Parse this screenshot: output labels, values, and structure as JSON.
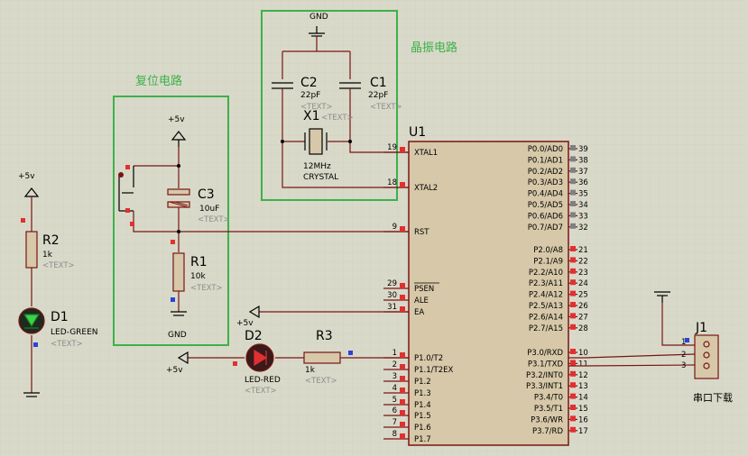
{
  "titles": {
    "reset": "复位电路",
    "crystal": "晶振电路"
  },
  "crystal": {
    "gnd": "GND",
    "c2": {
      "ref": "C2",
      "value": "22pF",
      "text": "<TEXT>"
    },
    "c1": {
      "ref": "C1",
      "value": "22pF",
      "text": "<TEXT>"
    },
    "x1": {
      "ref": "X1",
      "freq": "12MHz",
      "type": "CRYSTAL",
      "text": "<TEXT>"
    }
  },
  "reset": {
    "vcc": "+5v",
    "c3": {
      "ref": "C3",
      "value": "10uF",
      "text": "<TEXT>"
    },
    "r1": {
      "ref": "R1",
      "value": "10k",
      "text": "<TEXT>"
    },
    "gnd": "GND"
  },
  "left": {
    "vcc": "+5v",
    "r2": {
      "ref": "R2",
      "value": "1k",
      "text": "<TEXT>"
    },
    "d1": {
      "ref": "D1",
      "value": "LED-GREEN",
      "text": "<TEXT>"
    }
  },
  "bottom": {
    "vcc_d2": "+5v",
    "vcc_arrow": "+5v",
    "d2": {
      "ref": "D2",
      "value": "LED-RED",
      "text": "<TEXT>"
    },
    "r3": {
      "ref": "R3",
      "value": "1k",
      "text": "<TEXT>"
    }
  },
  "u1": {
    "ref": "U1",
    "left_pins": [
      {
        "num": "19",
        "name": "XTAL1"
      },
      {
        "num": "18",
        "name": "XTAL2"
      },
      {
        "num": "9",
        "name": "RST"
      },
      {
        "num": "29",
        "name": "PSEN"
      },
      {
        "num": "30",
        "name": "ALE"
      },
      {
        "num": "31",
        "name": "EA"
      },
      {
        "num": "1",
        "name": "P1.0/T2"
      },
      {
        "num": "2",
        "name": "P1.1/T2EX"
      },
      {
        "num": "3",
        "name": "P1.2"
      },
      {
        "num": "4",
        "name": "P1.3"
      },
      {
        "num": "5",
        "name": "P1.4"
      },
      {
        "num": "6",
        "name": "P1.5"
      },
      {
        "num": "7",
        "name": "P1.6"
      },
      {
        "num": "8",
        "name": "P1.7"
      }
    ],
    "right_pins": [
      {
        "num": "39",
        "name": "P0.0/AD0"
      },
      {
        "num": "38",
        "name": "P0.1/AD1"
      },
      {
        "num": "37",
        "name": "P0.2/AD2"
      },
      {
        "num": "36",
        "name": "P0.3/AD3"
      },
      {
        "num": "35",
        "name": "P0.4/AD4"
      },
      {
        "num": "34",
        "name": "P0.5/AD5"
      },
      {
        "num": "33",
        "name": "P0.6/AD6"
      },
      {
        "num": "32",
        "name": "P0.7/AD7"
      },
      {
        "num": "21",
        "name": "P2.0/A8"
      },
      {
        "num": "22",
        "name": "P2.1/A9"
      },
      {
        "num": "23",
        "name": "P2.2/A10"
      },
      {
        "num": "24",
        "name": "P2.3/A11"
      },
      {
        "num": "25",
        "name": "P2.4/A12"
      },
      {
        "num": "26",
        "name": "P2.5/A13"
      },
      {
        "num": "27",
        "name": "P2.6/A14"
      },
      {
        "num": "28",
        "name": "P2.7/A15"
      },
      {
        "num": "10",
        "name": "P3.0/RXD"
      },
      {
        "num": "11",
        "name": "P3.1/TXD"
      },
      {
        "num": "12",
        "name": "P3.2/INT0"
      },
      {
        "num": "13",
        "name": "P3.3/INT1"
      },
      {
        "num": "14",
        "name": "P3.4/T0"
      },
      {
        "num": "15",
        "name": "P3.5/T1"
      },
      {
        "num": "16",
        "name": "P3.6/WR"
      },
      {
        "num": "17",
        "name": "P3.7/RD"
      }
    ]
  },
  "j1": {
    "ref": "J1",
    "pins": [
      "1",
      "2",
      "3"
    ],
    "label": "串口下载"
  },
  "colors": {
    "wire": "#7a1414",
    "frame": "#3cb14b",
    "chip": "#d6c8a8",
    "background": "#d9d9c9"
  }
}
